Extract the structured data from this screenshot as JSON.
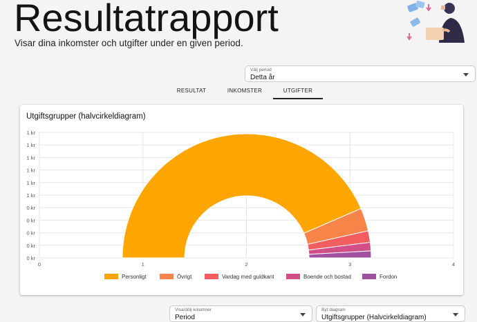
{
  "header": {
    "title": "Resultatrapport",
    "subtitle": "Visar dina inkomster och utgifter under en given period."
  },
  "period_select": {
    "label": "Välj period",
    "value": "Detta år"
  },
  "tabs": [
    {
      "label": "RESULTAT",
      "active": false
    },
    {
      "label": "INKOMSTER",
      "active": false
    },
    {
      "label": "UTGIFTER",
      "active": true
    }
  ],
  "card": {
    "title": "Utgiftsgrupper (halvcirkeldiagram)"
  },
  "chart_data": {
    "type": "pie",
    "subtype": "semicircle-donut",
    "title": "Utgiftsgrupper (halvcirkeldiagram)",
    "y_tick_labels": [
      "1 kr",
      "1 kr",
      "1 kr",
      "1 kr",
      "1 kr",
      "1 kr",
      "0 kr",
      "0 kr",
      "0 kr",
      "0 kr",
      "0 kr"
    ],
    "x_tick_labels": [
      "0",
      "1",
      "2",
      "3",
      "4"
    ],
    "grid": true,
    "legend_position": "bottom",
    "series": [
      {
        "name": "Personligt",
        "value": 87.0,
        "color": "#FFA500"
      },
      {
        "name": "Övrigt",
        "value": 6.0,
        "color": "#F7854A"
      },
      {
        "name": "Vardag med guldkant",
        "value": 3.0,
        "color": "#F25D60"
      },
      {
        "name": "Boende och bostad",
        "value": 2.2,
        "color": "#D14E86"
      },
      {
        "name": "Fordon",
        "value": 1.8,
        "color": "#A0509C"
      }
    ]
  },
  "bottom_selects": [
    {
      "label": "Visa/dölj kolumner",
      "value": "Period"
    },
    {
      "label": "Byt diagram",
      "value": "Utgiftsgrupper (Halvcirkeldiagram)"
    }
  ]
}
